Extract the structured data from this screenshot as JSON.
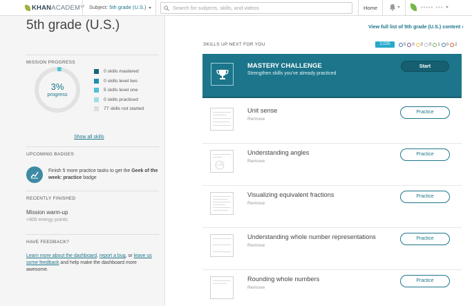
{
  "nav": {
    "logo_bold": "KHAN",
    "logo_light": "ACADEMY",
    "subject_label": "Subject: ",
    "subject_value": "5th grade (U.S.)",
    "search_placeholder": "Search for subjects, skills, and videos",
    "home": "Home",
    "user_name": "▪▪▪▪▪ ▪▪▪"
  },
  "sidebar": {
    "grade_title": "5th grade (U.S.)",
    "mission_progress": {
      "heading": "MISSION PROGRESS",
      "percent": "3%",
      "percent_label": "progress",
      "progress_fraction": 0.03,
      "legend": [
        {
          "label": "0 skills mastered",
          "color": "#14647a"
        },
        {
          "label": "0 skills level two",
          "color": "#1f8fb0"
        },
        {
          "label": "5 skills level one",
          "color": "#4fc0d8"
        },
        {
          "label": "0 skills practiced",
          "color": "#9fdde8"
        },
        {
          "label": "77 skills not started",
          "color": "#dddddd"
        }
      ],
      "show_all": "Show all skills"
    },
    "upcoming_badges": {
      "heading": "UPCOMING BADGES",
      "text_before": "Finish 5 more practice tasks to get the ",
      "badge_name": "Geek of the week: practice",
      "text_after": " badge"
    },
    "recently_finished": {
      "heading": "RECENTLY FINISHED",
      "title": "Mission warm-up",
      "points": "+800 energy points"
    },
    "feedback": {
      "heading": "HAVE FEEDBACK?",
      "link1": "Learn more about the dashboard",
      "sep1": ", ",
      "link2": "report a bug",
      "sep2": ", or ",
      "link3": "leave us some feedback",
      "tail": " and help make the dashboard more awesome."
    }
  },
  "main": {
    "view_full": "View full list of 5th grade (U.S.) content ›",
    "skills_heading": "SKILLS UP NEXT FOR YOU",
    "energy_points": "2,025",
    "badge_counts": [
      {
        "count": "5",
        "color": "#3b6fb6"
      },
      {
        "count": "0",
        "color": "#7a4b9b"
      },
      {
        "count": "0",
        "color": "#e8c547"
      },
      {
        "count": "0",
        "color": "#c0c0c0"
      },
      {
        "count": "1",
        "color": "#6fb05a"
      },
      {
        "count": "0",
        "color": "#3f7fb0"
      },
      {
        "count": "2",
        "color": "#d9552c"
      }
    ],
    "mastery": {
      "title": "MASTERY CHALLENGE",
      "subtitle": "Strengthen skills you've already practiced",
      "button": "Start"
    },
    "skills": [
      {
        "title": "Unit sense",
        "remove": "Remove",
        "button": "Practice"
      },
      {
        "title": "Understanding angles",
        "remove": "Remove",
        "button": "Practice"
      },
      {
        "title": "Visualizing equivalent fractions",
        "remove": "Remove",
        "button": "Practice"
      },
      {
        "title": "Understanding whole number representations",
        "remove": "Remove",
        "button": "Practice"
      },
      {
        "title": "Rounding whole numbers",
        "remove": "Remove",
        "button": "Practice"
      }
    ]
  }
}
